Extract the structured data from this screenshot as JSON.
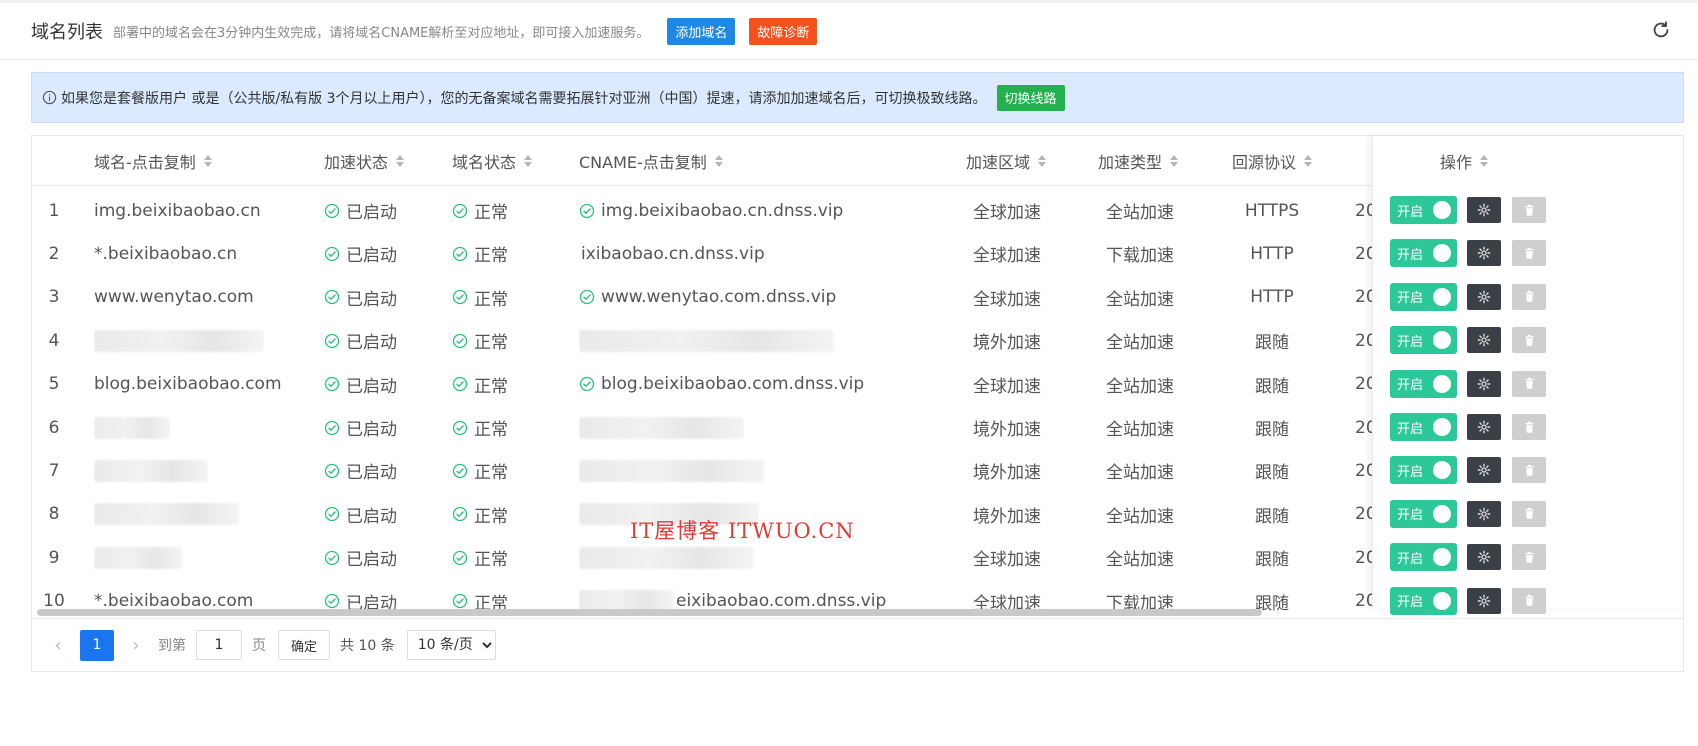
{
  "header": {
    "title": "域名列表",
    "description": "部署中的域名会在3分钟内生效完成，请将域名CNAME解析至对应地址，即可接入加速服务。",
    "add_domain": "添加域名",
    "diagnose": "故障诊断"
  },
  "notice": {
    "text": "如果您是套餐版用户 或是（公共版/私有版 3个月以上用户），您的无备案域名需要拓展针对亚洲（中国）提速，请添加加速域名后，可切换极致线路。",
    "switch_label": "切换线路"
  },
  "columns": {
    "domain": "域名-点击复制",
    "accel_status": "加速状态",
    "domain_status": "域名状态",
    "cname": "CNAME-点击复制",
    "region": "加速区域",
    "type": "加速类型",
    "protocol": "回源协议",
    "actions": "操作"
  },
  "rows": [
    {
      "index": "1",
      "domain": "img.beixibaobao.cn",
      "accel": "已启动",
      "status": "正常",
      "cname": "img.beixibaobao.cn.dnss.vip",
      "region": "全球加速",
      "type": "全站加速",
      "protocol": "HTTPS",
      "date": "20",
      "toggle": "开启"
    },
    {
      "index": "2",
      "domain": "*.beixibaobao.cn",
      "accel": "已启动",
      "status": "正常",
      "cname": "ixibaobao.cn.dnss.vip",
      "region": "全球加速",
      "type": "下载加速",
      "protocol": "HTTP",
      "date": "20",
      "toggle": "开启"
    },
    {
      "index": "3",
      "domain": "www.wenytao.com",
      "accel": "已启动",
      "status": "正常",
      "cname": "www.wenytao.com.dnss.vip",
      "region": "全球加速",
      "type": "全站加速",
      "protocol": "HTTP",
      "date": "20",
      "toggle": "开启"
    },
    {
      "index": "4",
      "domain": "",
      "accel": "已启动",
      "status": "正常",
      "cname": "",
      "region": "境外加速",
      "type": "全站加速",
      "protocol": "跟随",
      "date": "20",
      "toggle": "开启"
    },
    {
      "index": "5",
      "domain": "blog.beixibaobao.com",
      "accel": "已启动",
      "status": "正常",
      "cname": "blog.beixibaobao.com.dnss.vip",
      "region": "全球加速",
      "type": "全站加速",
      "protocol": "跟随",
      "date": "20",
      "toggle": "开启"
    },
    {
      "index": "6",
      "domain": "",
      "accel": "已启动",
      "status": "正常",
      "cname": "",
      "region": "境外加速",
      "type": "全站加速",
      "protocol": "跟随",
      "date": "20",
      "toggle": "开启"
    },
    {
      "index": "7",
      "domain": "",
      "accel": "已启动",
      "status": "正常",
      "cname": "",
      "region": "境外加速",
      "type": "全站加速",
      "protocol": "跟随",
      "date": "20",
      "toggle": "开启"
    },
    {
      "index": "8",
      "domain": "",
      "accel": "已启动",
      "status": "正常",
      "cname": "",
      "region": "境外加速",
      "type": "全站加速",
      "protocol": "跟随",
      "date": "20",
      "toggle": "开启"
    },
    {
      "index": "9",
      "domain": "",
      "accel": "已启动",
      "status": "正常",
      "cname": "",
      "region": "全球加速",
      "type": "全站加速",
      "protocol": "跟随",
      "date": "20",
      "toggle": "开启"
    },
    {
      "index": "10",
      "domain": "*.beixibaobao.com",
      "accel": "已启动",
      "status": "正常",
      "cname": "eixibaobao.com.dnss.vip",
      "region": "全球加速",
      "type": "下载加速",
      "protocol": "跟随",
      "date": "20",
      "toggle": "开启"
    }
  ],
  "pagination": {
    "current_page": "1",
    "goto_label": "到第",
    "page_input": "1",
    "page_suffix": "页",
    "confirm": "确定",
    "total": "共 10 条",
    "page_size": "10 条/页"
  },
  "watermark": "IT屋博客 ITWUO.CN",
  "colors": {
    "primary": "#1e88e5",
    "danger": "#f4511e",
    "success": "#22b14c",
    "toggle_on": "#2dc89a",
    "notice_bg": "#dbeaff"
  },
  "icons": {
    "refresh": "refresh-icon",
    "info": "info-icon",
    "ok": "check-circle-icon",
    "gear": "gear-icon",
    "trash": "trash-icon"
  }
}
